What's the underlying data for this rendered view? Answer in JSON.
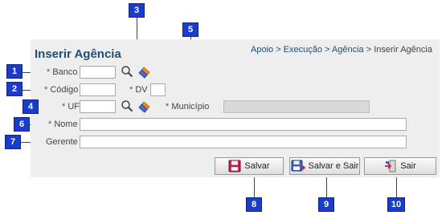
{
  "page": {
    "title": "Inserir Agência",
    "breadcrumb": {
      "path": "Apoio > Execução > Agência > ",
      "current": "Inserir Agência"
    }
  },
  "form": {
    "required_mark": "*",
    "banco_label": "Banco",
    "codigo_label": "Código",
    "dv_label": "DV",
    "uf_label": "UF",
    "municipio_label": "Município",
    "nome_label": "Nome",
    "gerente_label": "Gerente",
    "banco_value": "",
    "codigo_value": "",
    "dv_value": "",
    "uf_value": "",
    "municipio_value": "",
    "nome_value": "",
    "gerente_value": ""
  },
  "buttons": {
    "save": "Salvar",
    "save_exit": "Salvar e Sair",
    "exit": "Sair"
  },
  "callouts": [
    "1",
    "2",
    "3",
    "4",
    "5",
    "6",
    "7",
    "8",
    "9",
    "10"
  ],
  "colors": {
    "callout": "#1a3cc8",
    "title": "#1f4e79",
    "panel": "#eeeeee"
  }
}
